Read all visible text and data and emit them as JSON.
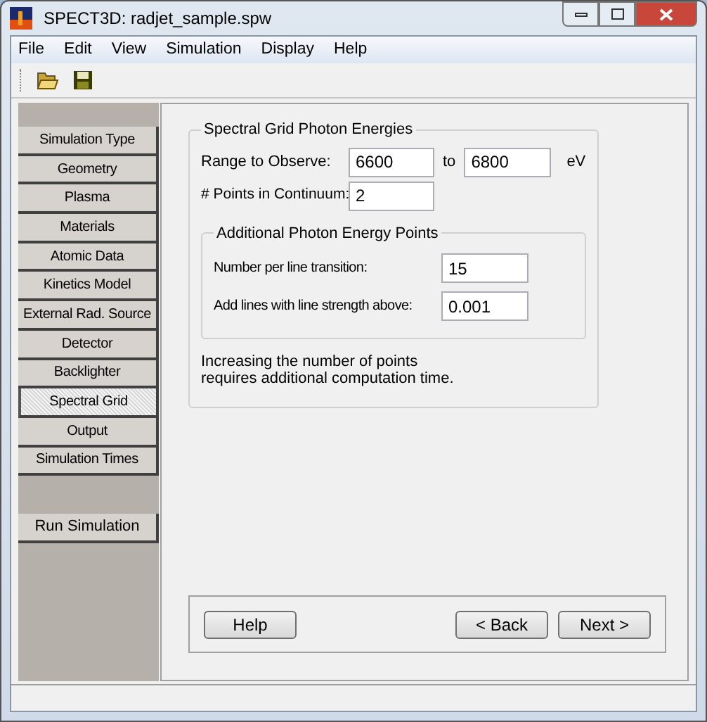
{
  "window": {
    "title": "SPECT3D:  radjet_sample.spw"
  },
  "menu": [
    "File",
    "Edit",
    "View",
    "Simulation",
    "Display",
    "Help"
  ],
  "toolbar": [
    {
      "kind": "open"
    },
    {
      "kind": "save"
    }
  ],
  "sidebar": {
    "items": [
      {
        "label": "Simulation Type",
        "selected": false
      },
      {
        "label": "Geometry",
        "selected": false
      },
      {
        "label": "Plasma",
        "selected": false
      },
      {
        "label": "Materials",
        "selected": false
      },
      {
        "label": "Atomic Data",
        "selected": false
      },
      {
        "label": "Kinetics Model",
        "selected": false
      },
      {
        "label": "External Rad. Source",
        "selected": false
      },
      {
        "label": "Detector",
        "selected": false
      },
      {
        "label": "Backlighter",
        "selected": false
      },
      {
        "label": "Spectral Grid",
        "selected": true
      },
      {
        "label": "Output",
        "selected": false
      },
      {
        "label": "Simulation Times",
        "selected": false
      }
    ],
    "run_button": "Run Simulation"
  },
  "group": {
    "title": "Spectral Grid Photon Energies",
    "range": {
      "label": "Range to Observe:",
      "from": "6600",
      "to_label": "to",
      "to": "6800",
      "unit": "eV"
    },
    "points": {
      "label": "# Points in Continuum:",
      "value": "2"
    },
    "additional": {
      "title": "Additional Photon Energy Points",
      "fields": [
        {
          "label": "Number per line transition:",
          "value": "15"
        },
        {
          "label": "Add lines with line strength above:",
          "value": "0.001"
        }
      ]
    },
    "note": [
      "Increasing the number of points",
      "requires additional computation time."
    ]
  },
  "buttons": {
    "help": "Help",
    "back": "< Back",
    "next": "Next >"
  }
}
